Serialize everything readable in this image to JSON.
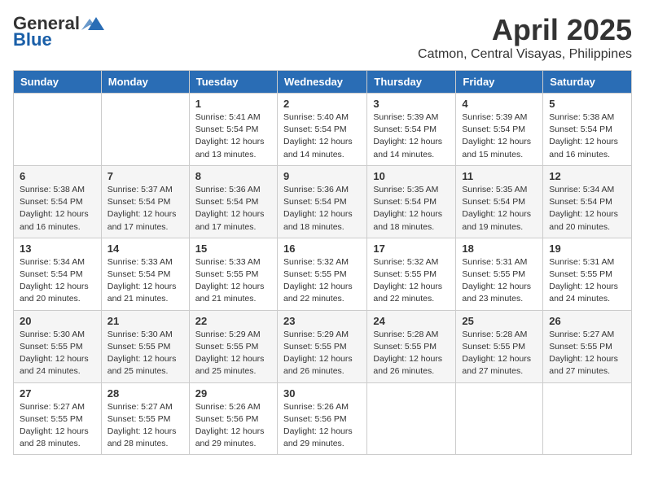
{
  "header": {
    "logo_general": "General",
    "logo_blue": "Blue",
    "month_title": "April 2025",
    "location": "Catmon, Central Visayas, Philippines"
  },
  "days_of_week": [
    "Sunday",
    "Monday",
    "Tuesday",
    "Wednesday",
    "Thursday",
    "Friday",
    "Saturday"
  ],
  "weeks": [
    [
      {
        "day": "",
        "info": ""
      },
      {
        "day": "",
        "info": ""
      },
      {
        "day": "1",
        "info": "Sunrise: 5:41 AM\nSunset: 5:54 PM\nDaylight: 12 hours\nand 13 minutes."
      },
      {
        "day": "2",
        "info": "Sunrise: 5:40 AM\nSunset: 5:54 PM\nDaylight: 12 hours\nand 14 minutes."
      },
      {
        "day": "3",
        "info": "Sunrise: 5:39 AM\nSunset: 5:54 PM\nDaylight: 12 hours\nand 14 minutes."
      },
      {
        "day": "4",
        "info": "Sunrise: 5:39 AM\nSunset: 5:54 PM\nDaylight: 12 hours\nand 15 minutes."
      },
      {
        "day": "5",
        "info": "Sunrise: 5:38 AM\nSunset: 5:54 PM\nDaylight: 12 hours\nand 16 minutes."
      }
    ],
    [
      {
        "day": "6",
        "info": "Sunrise: 5:38 AM\nSunset: 5:54 PM\nDaylight: 12 hours\nand 16 minutes."
      },
      {
        "day": "7",
        "info": "Sunrise: 5:37 AM\nSunset: 5:54 PM\nDaylight: 12 hours\nand 17 minutes."
      },
      {
        "day": "8",
        "info": "Sunrise: 5:36 AM\nSunset: 5:54 PM\nDaylight: 12 hours\nand 17 minutes."
      },
      {
        "day": "9",
        "info": "Sunrise: 5:36 AM\nSunset: 5:54 PM\nDaylight: 12 hours\nand 18 minutes."
      },
      {
        "day": "10",
        "info": "Sunrise: 5:35 AM\nSunset: 5:54 PM\nDaylight: 12 hours\nand 18 minutes."
      },
      {
        "day": "11",
        "info": "Sunrise: 5:35 AM\nSunset: 5:54 PM\nDaylight: 12 hours\nand 19 minutes."
      },
      {
        "day": "12",
        "info": "Sunrise: 5:34 AM\nSunset: 5:54 PM\nDaylight: 12 hours\nand 20 minutes."
      }
    ],
    [
      {
        "day": "13",
        "info": "Sunrise: 5:34 AM\nSunset: 5:54 PM\nDaylight: 12 hours\nand 20 minutes."
      },
      {
        "day": "14",
        "info": "Sunrise: 5:33 AM\nSunset: 5:54 PM\nDaylight: 12 hours\nand 21 minutes."
      },
      {
        "day": "15",
        "info": "Sunrise: 5:33 AM\nSunset: 5:55 PM\nDaylight: 12 hours\nand 21 minutes."
      },
      {
        "day": "16",
        "info": "Sunrise: 5:32 AM\nSunset: 5:55 PM\nDaylight: 12 hours\nand 22 minutes."
      },
      {
        "day": "17",
        "info": "Sunrise: 5:32 AM\nSunset: 5:55 PM\nDaylight: 12 hours\nand 22 minutes."
      },
      {
        "day": "18",
        "info": "Sunrise: 5:31 AM\nSunset: 5:55 PM\nDaylight: 12 hours\nand 23 minutes."
      },
      {
        "day": "19",
        "info": "Sunrise: 5:31 AM\nSunset: 5:55 PM\nDaylight: 12 hours\nand 24 minutes."
      }
    ],
    [
      {
        "day": "20",
        "info": "Sunrise: 5:30 AM\nSunset: 5:55 PM\nDaylight: 12 hours\nand 24 minutes."
      },
      {
        "day": "21",
        "info": "Sunrise: 5:30 AM\nSunset: 5:55 PM\nDaylight: 12 hours\nand 25 minutes."
      },
      {
        "day": "22",
        "info": "Sunrise: 5:29 AM\nSunset: 5:55 PM\nDaylight: 12 hours\nand 25 minutes."
      },
      {
        "day": "23",
        "info": "Sunrise: 5:29 AM\nSunset: 5:55 PM\nDaylight: 12 hours\nand 26 minutes."
      },
      {
        "day": "24",
        "info": "Sunrise: 5:28 AM\nSunset: 5:55 PM\nDaylight: 12 hours\nand 26 minutes."
      },
      {
        "day": "25",
        "info": "Sunrise: 5:28 AM\nSunset: 5:55 PM\nDaylight: 12 hours\nand 27 minutes."
      },
      {
        "day": "26",
        "info": "Sunrise: 5:27 AM\nSunset: 5:55 PM\nDaylight: 12 hours\nand 27 minutes."
      }
    ],
    [
      {
        "day": "27",
        "info": "Sunrise: 5:27 AM\nSunset: 5:55 PM\nDaylight: 12 hours\nand 28 minutes."
      },
      {
        "day": "28",
        "info": "Sunrise: 5:27 AM\nSunset: 5:55 PM\nDaylight: 12 hours\nand 28 minutes."
      },
      {
        "day": "29",
        "info": "Sunrise: 5:26 AM\nSunset: 5:56 PM\nDaylight: 12 hours\nand 29 minutes."
      },
      {
        "day": "30",
        "info": "Sunrise: 5:26 AM\nSunset: 5:56 PM\nDaylight: 12 hours\nand 29 minutes."
      },
      {
        "day": "",
        "info": ""
      },
      {
        "day": "",
        "info": ""
      },
      {
        "day": "",
        "info": ""
      }
    ]
  ]
}
